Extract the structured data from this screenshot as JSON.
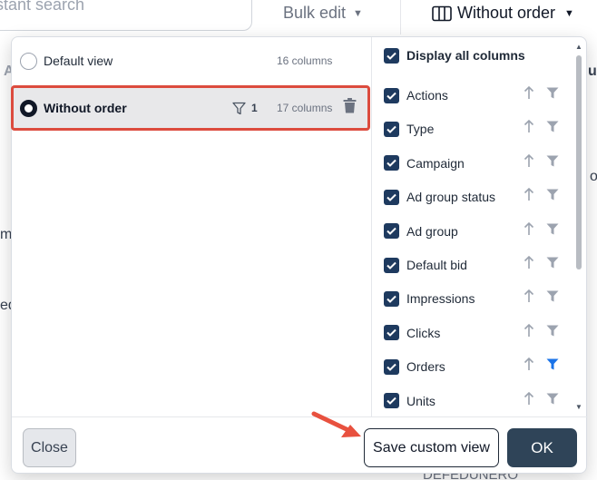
{
  "background": {
    "search_placeholder": "nstant search",
    "bulk_edit_label": "Bulk edit",
    "view_selector_label": "Without order",
    "left_fragments": [
      "A",
      "ms",
      "ed"
    ],
    "right_fragments": [
      "u",
      "o"
    ],
    "bottom_fragment": "DEFEDUNERO"
  },
  "views": [
    {
      "name": "Default view",
      "columns": "16 columns",
      "selected": false
    },
    {
      "name": "Without order",
      "columns": "17 columns",
      "filter_count": "1",
      "selected": true
    }
  ],
  "columns_panel": {
    "display_all_label": "Display all columns",
    "items": [
      {
        "label": "Actions",
        "filter_active": false
      },
      {
        "label": "Type",
        "filter_active": false
      },
      {
        "label": "Campaign",
        "filter_active": false
      },
      {
        "label": "Ad group status",
        "filter_active": false
      },
      {
        "label": "Ad group",
        "filter_active": false
      },
      {
        "label": "Default bid",
        "filter_active": false
      },
      {
        "label": "Impressions",
        "filter_active": false
      },
      {
        "label": "Clicks",
        "filter_active": false
      },
      {
        "label": "Orders",
        "filter_active": true
      },
      {
        "label": "Units",
        "filter_active": false
      }
    ]
  },
  "footer": {
    "close_label": "Close",
    "save_label": "Save custom view",
    "ok_label": "OK"
  },
  "colors": {
    "checkbox": "#1e3a5f",
    "active_filter": "#1a73e8",
    "highlight_box": "#dc4b3e",
    "ok_button": "#2f4458"
  }
}
